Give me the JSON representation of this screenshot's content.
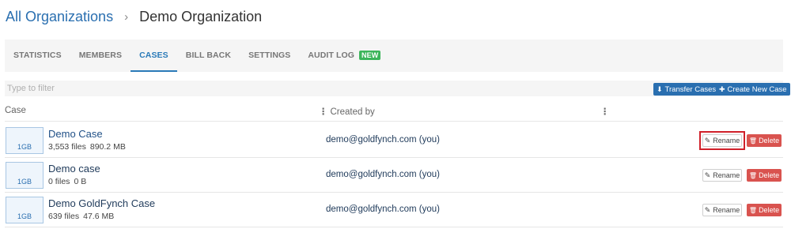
{
  "breadcrumb": {
    "root": "All Organizations",
    "separator": "›",
    "current": "Demo Organization"
  },
  "tabs": [
    {
      "label": "STATISTICS",
      "active": false
    },
    {
      "label": "MEMBERS",
      "active": false
    },
    {
      "label": "CASES",
      "active": true
    },
    {
      "label": "BILL BACK",
      "active": false
    },
    {
      "label": "SETTINGS",
      "active": false
    },
    {
      "label": "AUDIT LOG",
      "active": false,
      "badge": "NEW"
    }
  ],
  "filter": {
    "placeholder": "Type to filter",
    "value": ""
  },
  "actions": {
    "transfer": {
      "label": "Transfer Cases",
      "icon": "download-icon"
    },
    "create": {
      "label": "Create New Case",
      "icon": "plus-icon"
    }
  },
  "table": {
    "headers": {
      "case": "Case",
      "created_by": "Created by"
    },
    "rows": [
      {
        "thumb": "1GB",
        "name": "Demo Case",
        "files": "3,553 files",
        "size": "890.2 MB",
        "created_by": "demo@goldfynch.com (you)",
        "rename": "Rename",
        "delete": "Delete",
        "highlighted": true
      },
      {
        "thumb": "1GB",
        "name": "Demo case",
        "files": "0 files",
        "size": "0 B",
        "created_by": "demo@goldfynch.com (you)",
        "rename": "Rename",
        "delete": "Delete",
        "highlighted": false
      },
      {
        "thumb": "1GB",
        "name": "Demo GoldFynch Case",
        "files": "639 files",
        "size": "47.6 MB",
        "created_by": "demo@goldfynch.com (you)",
        "rename": "Rename",
        "delete": "Delete",
        "highlighted": false
      }
    ]
  },
  "colors": {
    "accent": "#2a6fb0",
    "badge_new": "#3cb55a",
    "delete": "#d9534f",
    "highlight": "#d0202a"
  }
}
